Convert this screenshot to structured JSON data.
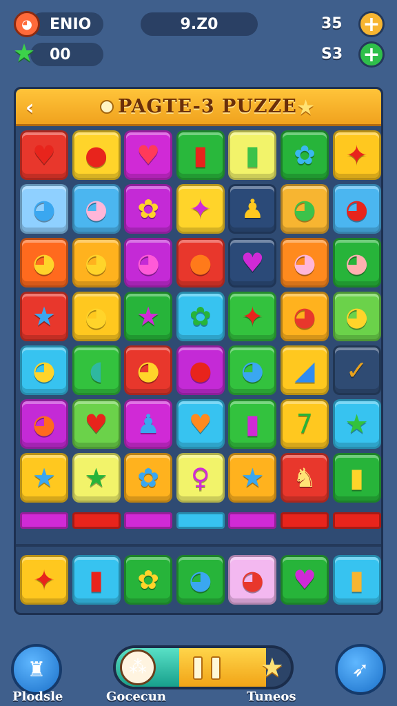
{
  "hud": {
    "player_name": "ENIO",
    "score": "9.Z0",
    "stars": "00",
    "resource_1": "35",
    "resource_2": "S3"
  },
  "board": {
    "title": "PAGTE-3 PUZZE",
    "back_icon": "back-arrow-icon",
    "title_star_icon": "star-icon"
  },
  "colors": {
    "background": "#3f5f8c",
    "board": "#2f4b73",
    "title_bar": "#ffc43a",
    "accent_orange": "#f7b531",
    "accent_green": "#2fbf4a"
  },
  "tiles": [
    [
      {
        "c": "#e8372c",
        "g": "♥",
        "i": "cat-heart-icon"
      },
      {
        "c": "#ffd42a",
        "g": "●",
        "gc": "#e8241c",
        "i": "apple-icon"
      },
      {
        "c": "#d02ad6",
        "g": "♥",
        "gc": "#ff3a5a",
        "i": "cat-heart-icon"
      },
      {
        "c": "#29b83c",
        "g": "▮",
        "gc": "#e8241c",
        "i": "marker-icon"
      },
      {
        "c": "#f2f36a",
        "g": "▮",
        "gc": "#3cc24a",
        "i": "marker-icon"
      },
      {
        "c": "#27b43a",
        "g": "✿",
        "gc": "#3ab8f0",
        "i": "blob-icon"
      },
      {
        "c": "#ffc81f",
        "g": "✦",
        "gc": "#e8241c",
        "i": "cross-icon"
      }
    ],
    [
      {
        "c": "#8fd0ff",
        "g": "◕",
        "gc": "#3aa7f0",
        "i": "blue-cat-icon"
      },
      {
        "c": "#4bb6f0",
        "g": "◕",
        "gc": "#ffb6d8",
        "i": "pink-cat-icon"
      },
      {
        "c": "#c42ad6",
        "g": "✿",
        "gc": "#ffd42a",
        "i": "yellow-blob-icon"
      },
      {
        "c": "#ffd42a",
        "g": "✦",
        "gc": "#d02ad6",
        "i": "cross-icon"
      },
      {
        "c": "#2b4a78",
        "g": "♟",
        "gc": "#ffc81f",
        "i": "pawn-icon"
      },
      {
        "c": "#f7b531",
        "g": "◕",
        "gc": "#3cc24a",
        "i": "green-frog-icon"
      },
      {
        "c": "#4bb6f0",
        "g": "◕",
        "gc": "#e8241c",
        "i": "red-cat-icon"
      }
    ],
    [
      {
        "c": "#ff6a1e",
        "g": "◕",
        "gc": "#ffd42a",
        "i": "yellow-cat-icon"
      },
      {
        "c": "#ffb21e",
        "g": "◕",
        "gc": "#ffd42a",
        "i": "lion-icon"
      },
      {
        "c": "#c42ad6",
        "g": "◕",
        "gc": "#ff5ad8",
        "i": "pink-cat-icon"
      },
      {
        "c": "#e8372c",
        "g": "●",
        "gc": "#ff7a1a",
        "i": "orange-icon"
      },
      {
        "c": "#2b4a78",
        "g": "♥",
        "gc": "#d02ad6",
        "i": "heart-icon"
      },
      {
        "c": "#ff8a1e",
        "g": "◕",
        "gc": "#ffb6d8",
        "i": "pink-cat-icon"
      },
      {
        "c": "#27b43a",
        "g": "◕",
        "gc": "#ffb0b0",
        "i": "pink-cat-icon"
      }
    ],
    [
      {
        "c": "#e8372c",
        "g": "★",
        "gc": "#3aa7f0",
        "i": "blue-star-icon"
      },
      {
        "c": "#ffc81f",
        "g": "◕",
        "gc": "#ffd42a",
        "i": "lion-icon"
      },
      {
        "c": "#27b43a",
        "g": "★",
        "gc": "#d02ad6",
        "i": "star-heart-icon"
      },
      {
        "c": "#37c3f0",
        "g": "✿",
        "gc": "#27b43a",
        "i": "green-blob-icon"
      },
      {
        "c": "#33c23e",
        "g": "✦",
        "gc": "#e8241c",
        "i": "cross-icon"
      },
      {
        "c": "#ffb21e",
        "g": "◕",
        "gc": "#e8372c",
        "i": "red-lion-icon"
      },
      {
        "c": "#6bd24a",
        "g": "◕",
        "gc": "#ffd42a",
        "i": "yellow-cat-icon"
      }
    ],
    [
      {
        "c": "#37c3f0",
        "g": "◕",
        "gc": "#ffd42a",
        "i": "lion-icon"
      },
      {
        "c": "#33c23e",
        "g": "◖",
        "gc": "#2fb8a0",
        "i": "ghost-icon"
      },
      {
        "c": "#e8372c",
        "g": "◕",
        "gc": "#ffd42a",
        "i": "yellow-cat-icon"
      },
      {
        "c": "#c42ad6",
        "g": "●",
        "gc": "#e8241c",
        "i": "tomato-icon"
      },
      {
        "c": "#33c23e",
        "g": "◕",
        "gc": "#3aa7f0",
        "i": "blue-face-icon"
      },
      {
        "c": "#ffc81f",
        "g": "◢",
        "gc": "#2f8cf0",
        "i": "wedge-icon"
      },
      {
        "c": "#2f4b73",
        "g": "✓",
        "gc": "#e8a21e",
        "i": "check-icon"
      }
    ],
    [
      {
        "c": "#c42ad6",
        "g": "◕",
        "gc": "#ff6a1e",
        "i": "orange-cat-icon"
      },
      {
        "c": "#6bd24a",
        "g": "♥",
        "gc": "#e8241c",
        "i": "heart-icon"
      },
      {
        "c": "#d02ad6",
        "g": "♟",
        "gc": "#3aa7f0",
        "i": "blue-figure-icon"
      },
      {
        "c": "#37c3f0",
        "g": "♥",
        "gc": "#ff8a1e",
        "i": "orange-heart-icon"
      },
      {
        "c": "#33c23e",
        "g": "▮",
        "gc": "#d02ad6",
        "i": "marker-icon"
      },
      {
        "c": "#ffc81f",
        "g": "7",
        "gc": "#27b43a",
        "i": "seven-icon"
      },
      {
        "c": "#37c3f0",
        "g": "★",
        "gc": "#33c23e",
        "i": "green-star-icon"
      }
    ],
    [
      {
        "c": "#ffc81f",
        "g": "★",
        "gc": "#3aa7f0",
        "i": "blue-star-icon"
      },
      {
        "c": "#f2f36a",
        "g": "★",
        "gc": "#27b43a",
        "i": "green-star-icon"
      },
      {
        "c": "#ffb21e",
        "g": "✿",
        "gc": "#3aa7f0",
        "i": "blue-blob-icon"
      },
      {
        "c": "#f2f36a",
        "g": "♀",
        "gc": "#d02ad6",
        "i": "keyhole-icon"
      },
      {
        "c": "#ffb21e",
        "g": "★",
        "gc": "#3aa7f0",
        "i": "blue-star-icon"
      },
      {
        "c": "#e8372c",
        "g": "♞",
        "gc": "#ffe275",
        "i": "chess-knight-icon"
      },
      {
        "c": "#27b43a",
        "g": "▮",
        "gc": "#ffd42a",
        "i": "pencil-icon"
      }
    ]
  ],
  "strips": [
    "#d02ad6",
    "#e8241c",
    "#d02ad6",
    "#37c3f0",
    "#d02ad6",
    "#e8241c",
    "#e8241c"
  ],
  "tray": [
    {
      "c": "#ffc81f",
      "g": "✦",
      "gc": "#e8241c",
      "i": "cross-icon"
    },
    {
      "c": "#37c3f0",
      "g": "▮",
      "gc": "#e8241c",
      "i": "marker-icon"
    },
    {
      "c": "#27b43a",
      "g": "✿",
      "gc": "#ffd42a",
      "i": "yellow-blob-icon"
    },
    {
      "c": "#27b43a",
      "g": "◕",
      "gc": "#3aa7f0",
      "i": "blue-monster-icon"
    },
    {
      "c": "#f3b8f0",
      "g": "◕",
      "gc": "#e8372c",
      "i": "red-cat-icon"
    },
    {
      "c": "#27b43a",
      "g": "♥",
      "gc": "#d02ad6",
      "i": "butterfly-icon"
    },
    {
      "c": "#37c3f0",
      "g": "▮",
      "gc": "#f7b531",
      "i": "jar-icon"
    }
  ],
  "bottom": {
    "left_label": "Plodsle",
    "center_label": "Gocecun",
    "right_label": "Tuneos",
    "left_icon": "chef-hat-icon",
    "right_icon": "rocket-icon",
    "pause_icon": "pause-icon",
    "progress_star_icon": "star-icon",
    "progress_fraction": 0.86
  }
}
